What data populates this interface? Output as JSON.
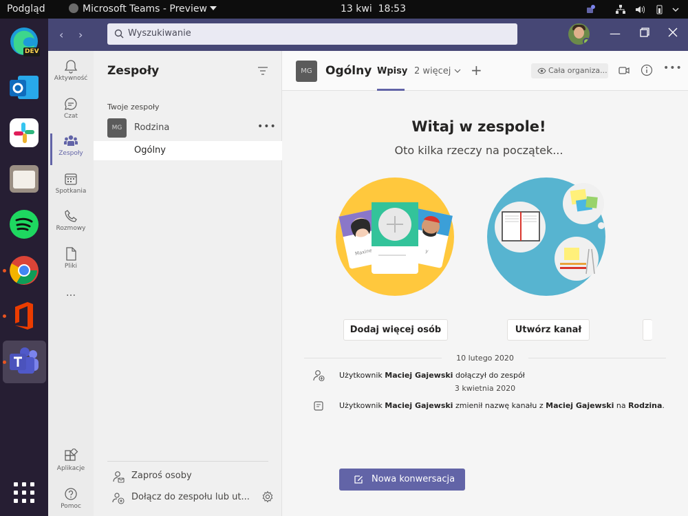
{
  "topbar": {
    "activities": "Podgląd",
    "app_name": "Microsoft Teams - Preview",
    "date": "13 kwi",
    "time": "18:53"
  },
  "dock": {
    "items": [
      {
        "name": "edge-dev",
        "badge": "DEV"
      },
      {
        "name": "outlook"
      },
      {
        "name": "slack"
      },
      {
        "name": "files"
      },
      {
        "name": "spotify"
      },
      {
        "name": "chrome"
      },
      {
        "name": "office"
      },
      {
        "name": "teams-preview"
      }
    ]
  },
  "titlebar": {
    "search_placeholder": "Wyszukiwanie",
    "status_color": "#92c353"
  },
  "rail": {
    "items": [
      {
        "label": "Aktywność",
        "icon": "bell-icon"
      },
      {
        "label": "Czat",
        "icon": "chat-icon"
      },
      {
        "label": "Zespoły",
        "icon": "teams-icon"
      },
      {
        "label": "Spotkania",
        "icon": "calendar-icon"
      },
      {
        "label": "Rozmowy",
        "icon": "phone-icon"
      },
      {
        "label": "Pliki",
        "icon": "file-icon"
      }
    ],
    "more": "...",
    "apps": "Aplikacje",
    "help": "Pomoc"
  },
  "teams_panel": {
    "title": "Zespoły",
    "section": "Twoje zespoły",
    "team": {
      "initials": "MG",
      "name": "Rodzina"
    },
    "channel": "Ogólny",
    "invite": "Zaproś osoby",
    "join": "Dołącz do zespołu lub ut..."
  },
  "channel_header": {
    "initials": "MG",
    "name": "Ogólny",
    "tab_active": "Wpisy",
    "tab_more": "2 więcej",
    "org": "Cała organiza..."
  },
  "main": {
    "welcome_title": "Witaj w zespole!",
    "welcome_sub": "Oto kilka rzeczy na początek...",
    "card_names": [
      "Maxine",
      "y"
    ],
    "add_people": "Dodaj więcej osób",
    "create_channel": "Utwórz kanał",
    "activity": [
      {
        "date": "10 lutego 2020",
        "prefix": "Użytkownik ",
        "user": "Maciej Gajewski",
        "text": " dołączył do zespół"
      },
      {
        "date": "3 kwietnia 2020",
        "prefix": "Użytkownik ",
        "user": "Maciej Gajewski",
        "mid": " zmienił nazwę kanału z ",
        "old": "Maciej Gajewski",
        "on": " na ",
        "new": "Rodzina",
        "end": "."
      }
    ],
    "new_conversation": "Nowa konwersacja"
  },
  "colors": {
    "accent": "#6264a7",
    "titlebar": "#464775"
  }
}
